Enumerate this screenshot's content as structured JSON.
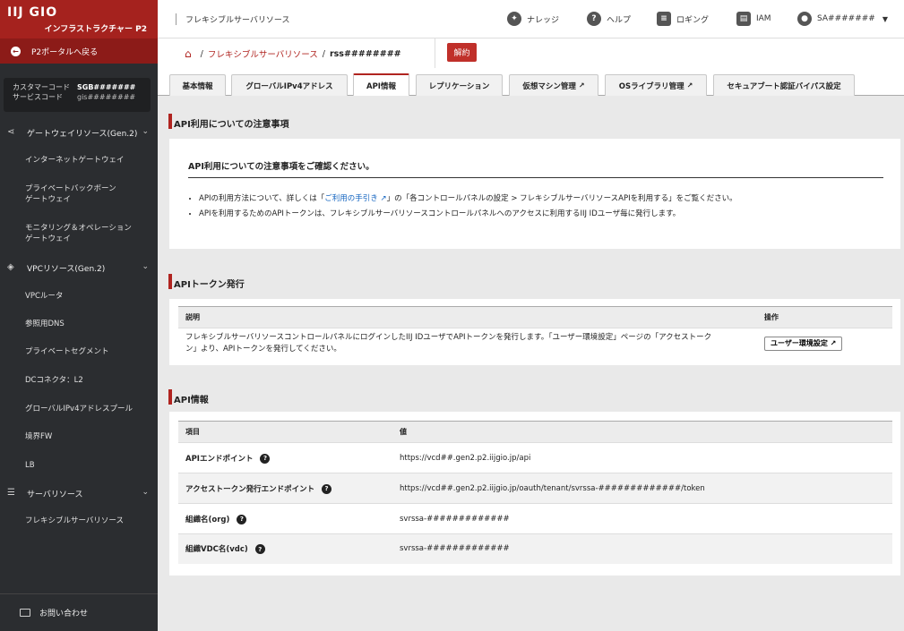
{
  "brand": {
    "logo": "IIJ GIO",
    "subtitle": "インフラストラクチャー P2"
  },
  "sidebar": {
    "portal_link": "P2ポータルへ戻る",
    "customer_code_label": "カスタマーコード",
    "customer_code_value": "SGB#######",
    "service_code_label": "サービスコード",
    "service_code_value": "gis########",
    "sections": [
      {
        "label": "ゲートウェイリソース(Gen.2)",
        "icon": "share-icon",
        "items": [
          "インターネットゲートウェイ",
          "プライベートバックボーン\nゲートウェイ",
          "モニタリング＆オペレーション\nゲートウェイ"
        ]
      },
      {
        "label": "VPCリソース(Gen.2)",
        "icon": "cube-icon",
        "items": [
          "VPCルータ",
          "参照用DNS",
          "プライベートセグメント",
          "DCコネクタ：L2",
          "グローバルIPv4アドレスプール",
          "境界FW",
          "LB"
        ]
      },
      {
        "label": "サーバリソース",
        "icon": "server-icon",
        "items": [
          "フレキシブルサーバリソース"
        ]
      }
    ],
    "contact": "お問い合わせ"
  },
  "header": {
    "title": "フレキシブルサーバリソース",
    "knowledge": "ナレッジ",
    "help": "ヘルプ",
    "logging": "ロギング",
    "iam": "IAM",
    "user": "SA#######"
  },
  "breadcrumb": {
    "service": "フレキシブルサーバリソース",
    "current": "rss########",
    "cancel_label": "解約"
  },
  "tabs": [
    "基本情報",
    "グローバルIPv4アドレス",
    "API情報",
    "レプリケーション",
    "仮想マシン管理",
    "OSライブラリ管理",
    "セキュアブート認証バイパス設定"
  ],
  "notice": {
    "section_title": "API利用についての注意事項",
    "heading": "API利用についての注意事項をご確認ください。",
    "item1_pre": "APIの利用方法について、詳しくは「",
    "item1_link": "ご利用の手引き",
    "item1_post": "」の「各コントロールパネルの設定 > フレキシブルサーバリソースAPIを利用する」をご覧ください。",
    "item2": "APIを利用するためのAPIトークンは、フレキシブルサーバリソースコントロールパネルへのアクセスに利用するIIJ IDユーザ毎に発行します。"
  },
  "token": {
    "section_title": "APIトークン発行",
    "col_desc": "説明",
    "col_op": "操作",
    "desc_line1": "フレキシブルサーバリソースコントロールパネルにログインしたIIJ IDユーザでAPIトークンを発行します。「ユーザー環境設定」ページの「アクセストーク",
    "desc_line2": "ン」より、APIトークンを発行してください。",
    "button_label": "ユーザー環境設定"
  },
  "api_info": {
    "section_title": "API情報",
    "col_item": "項目",
    "col_value": "値",
    "rows": [
      {
        "label": "APIエンドポイント",
        "value": "https://vcd##.gen2.p2.iijgio.jp/api"
      },
      {
        "label": "アクセストークン発行エンドポイント",
        "value": "https://vcd##.gen2.p2.iijgio.jp/oauth/tenant/svrssa-#############/token"
      },
      {
        "label": "組織名(org)",
        "value": "svrssa-#############"
      },
      {
        "label": "組織VDC名(vdc)",
        "value": "svrssa-#############"
      }
    ]
  }
}
